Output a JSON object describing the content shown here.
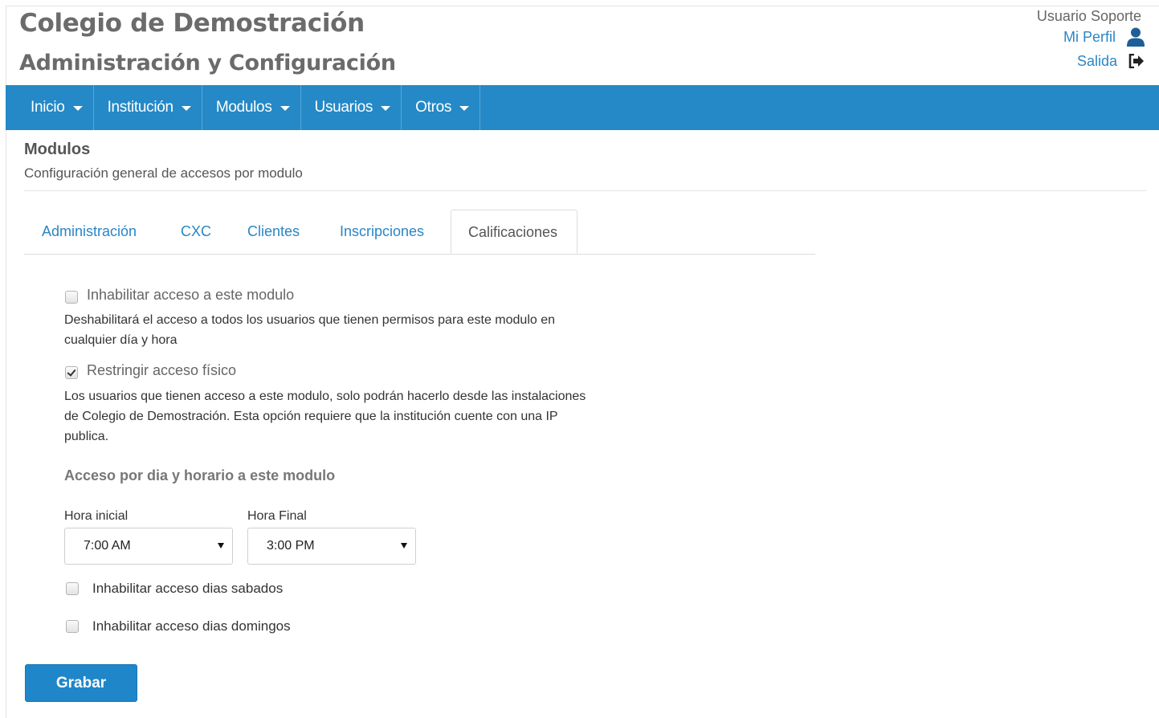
{
  "header": {
    "institution": "Colegio de Demostración",
    "title": "Administración y Configuración",
    "user_name": "Usuario Soporte",
    "profile_link": "Mi Perfil",
    "logout_link": "Salida"
  },
  "nav": {
    "items": [
      {
        "label": "Inicio"
      },
      {
        "label": "Institución"
      },
      {
        "label": "Modulos"
      },
      {
        "label": "Usuarios"
      },
      {
        "label": "Otros"
      }
    ]
  },
  "page": {
    "title": "Modulos",
    "description": "Configuración general de accesos por modulo"
  },
  "tabs": {
    "items": [
      {
        "label": "Administración"
      },
      {
        "label": "CXC"
      },
      {
        "label": "Clientes"
      },
      {
        "label": "Inscripciones"
      },
      {
        "label": "Calificaciones"
      }
    ],
    "active": "Calificaciones"
  },
  "settings": {
    "disable_access": {
      "label": "Inhabilitar acceso a este modulo",
      "checked": false,
      "help_line1": "Deshabilitará el acceso a todos los usuarios que tienen permisos para este modulo en",
      "help_line2": "cualquier día y hora"
    },
    "restrict_physical": {
      "label": "Restringir acceso físico",
      "checked": true,
      "help_line1": "Los usuarios que tienen acceso a este modulo, solo podrán hacerlo desde las instalaciones",
      "help_line2": "de Colegio de Demostración. Esta opción requiere que la institución cuente con una IP",
      "help_line3": "publica."
    },
    "schedule": {
      "title": "Acceso por dia y horario a este modulo",
      "start_label": "Hora inicial",
      "start_value": "7:00 AM",
      "end_label": "Hora Final",
      "end_value": "3:00 PM"
    },
    "disable_saturday": {
      "label": "Inhabilitar acceso dias sabados",
      "checked": false
    },
    "disable_sunday": {
      "label": "Inhabilitar acceso dias domingos",
      "checked": false
    }
  },
  "actions": {
    "save_label": "Grabar"
  },
  "colors": {
    "nav_background": "#2489c6",
    "link": "#2a86c5",
    "primary_button": "#1f86c9"
  },
  "icons": {
    "profile": "user-icon",
    "logout": "sign-out-icon",
    "nav_dropdown": "caret-down-icon",
    "select_arrow": "caret-down-icon"
  }
}
